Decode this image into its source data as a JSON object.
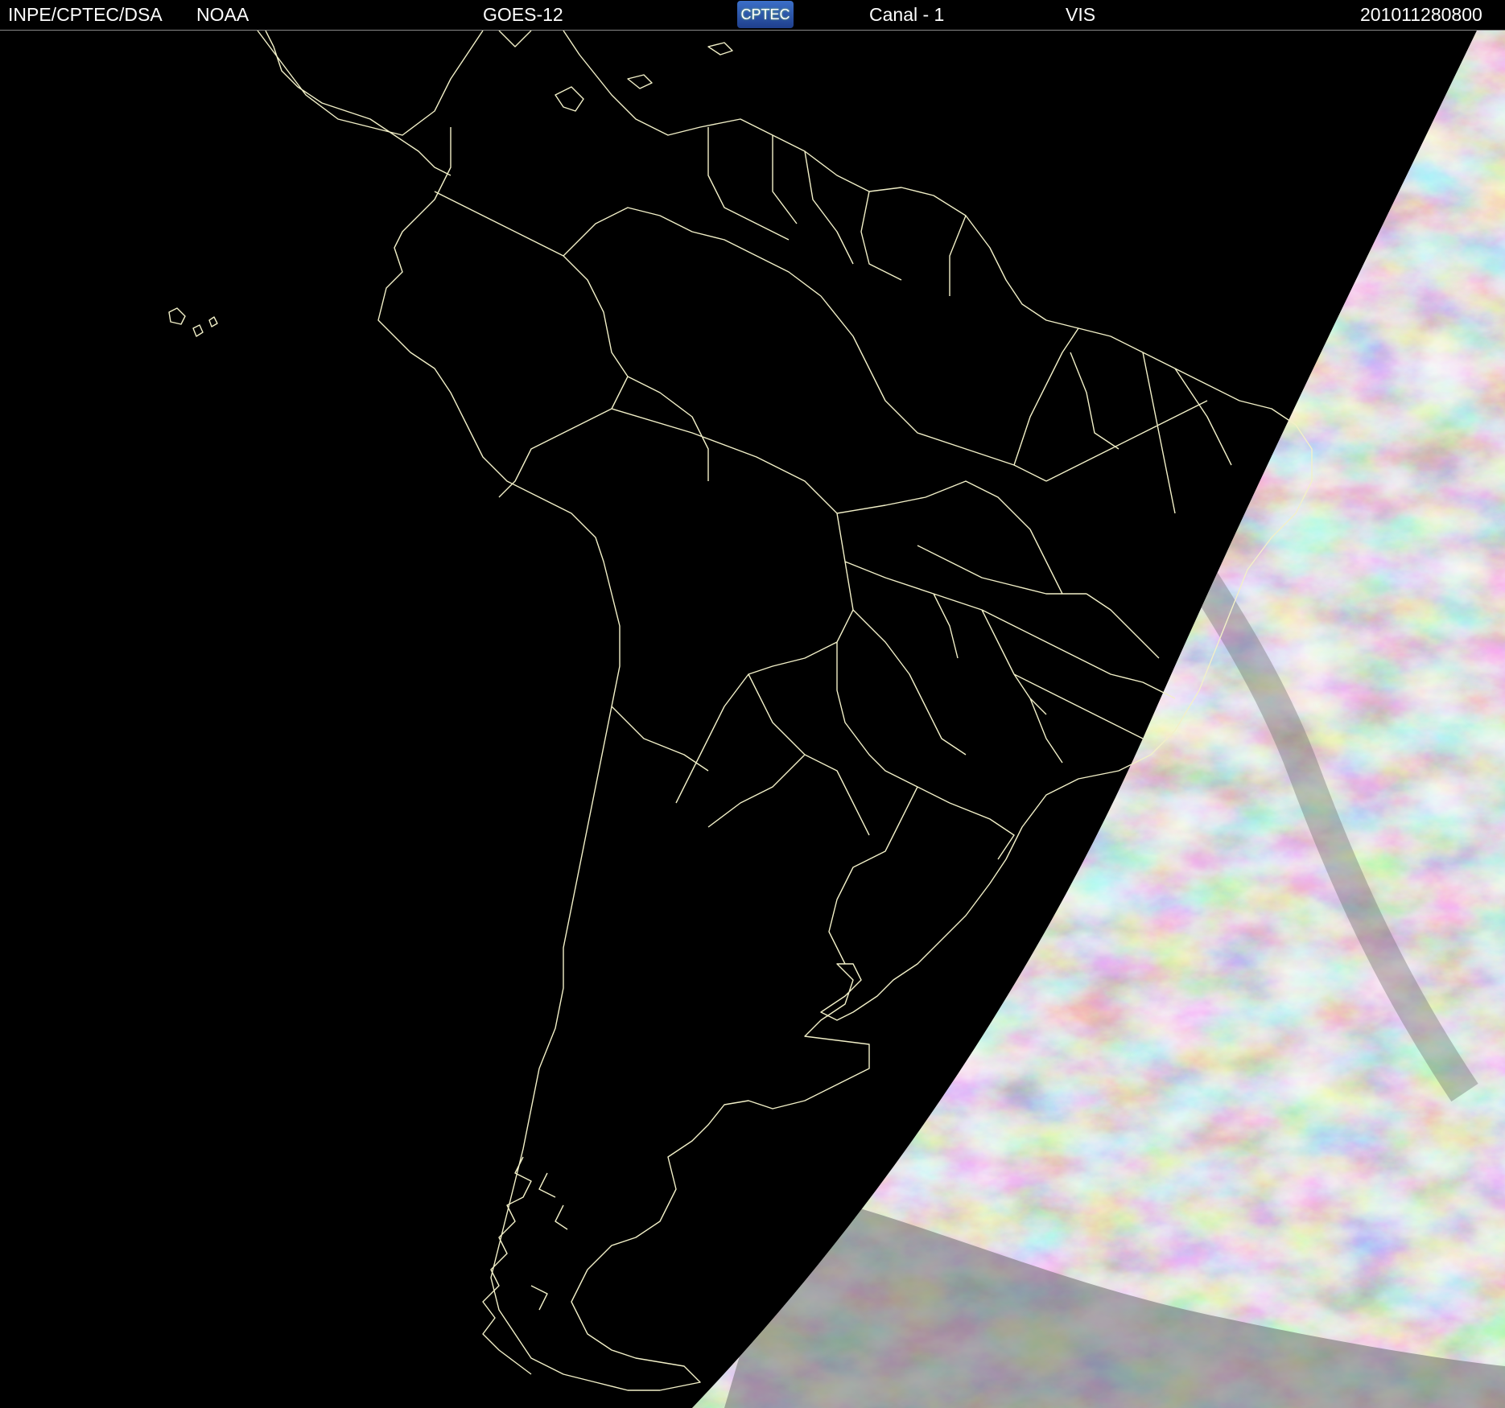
{
  "header": {
    "institution": "INPE/CPTEC/DSA",
    "agency": "NOAA",
    "satellite": "GOES-12",
    "logo_text": "CPTEC",
    "channel": "Canal - 1",
    "band": "VIS",
    "timestamp": "201011280800"
  },
  "colors": {
    "background": "#000000",
    "coastline": "#f2f0c8",
    "header_text": "#ffffff",
    "logo_bg": "#2e59b0",
    "clouds_light": "#e8e8e8",
    "clouds_dark": "#7a7a7a"
  }
}
